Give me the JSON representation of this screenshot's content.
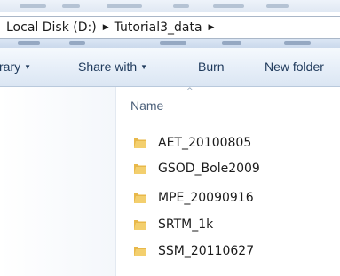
{
  "address": {
    "crumbs": [
      "Local Disk (D:)",
      "Tutorial3_data"
    ]
  },
  "toolbar": {
    "library_label": "rary",
    "share_label": "Share with",
    "burn_label": "Burn",
    "new_folder_label": "New folder"
  },
  "column": {
    "name_label": "Name"
  },
  "files": [
    {
      "name": "AET_20100805",
      "icon": "folder-icon"
    },
    {
      "name": "GSOD_Bole2009",
      "icon": "folder-icon"
    },
    {
      "name": "MPE_20090916",
      "icon": "folder-icon"
    },
    {
      "name": "SRTM_1k",
      "icon": "folder-icon"
    },
    {
      "name": "SSM_20110627",
      "icon": "folder-icon"
    }
  ],
  "colors": {
    "folder": "#e8b84a",
    "toolbar_text": "#1e395b",
    "accent": "#cbd9ec"
  }
}
